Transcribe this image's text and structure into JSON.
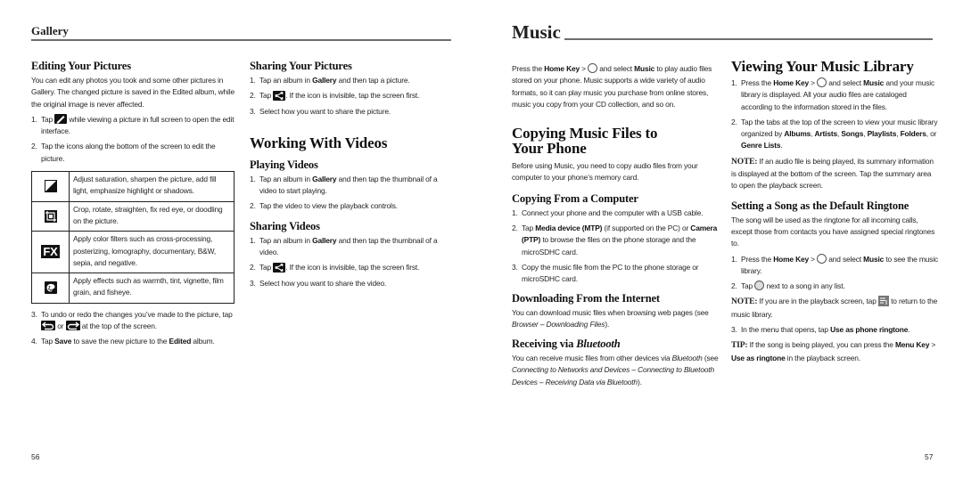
{
  "left_page": {
    "running_head": "Gallery",
    "page_number": "56",
    "editing": {
      "title": "Editing Your Pictures",
      "intro": "You can edit any photos you took and some other pictures in Gallery. The changed picture is saved in the Edited album, while the original image is never affected.",
      "step1_pre": "Tap",
      "step1_icon": "pencil-edit-icon",
      "step1_post": "while viewing a picture in full screen to open the edit interface.",
      "step2": "Tap the icons along the bottom of the screen to edit the picture.",
      "tools": [
        {
          "icon": "adjust-exposure-icon",
          "text": "Adjust saturation, sharpen the picture, add fill light, emphasize highlight or shadows."
        },
        {
          "icon": "crop-icon",
          "text": "Crop, rotate, straighten, fix red eye, or doodling on the picture."
        },
        {
          "icon": "fx-icon",
          "icon_text": "FX",
          "text": "Apply color filters such as cross-processing, posterizing, lomography, documentary, B&W, sepia, and negative."
        },
        {
          "icon": "palette-effects-icon",
          "text": "Apply effects such as warmth, tint, vignette, film grain, and fisheye."
        }
      ],
      "step3_pre": "To undo or redo the changes you’ve made to the picture, tap",
      "step3_mid": "or",
      "step3_post": "at the top of the screen.",
      "step4_pre": "Tap",
      "step4_bold1": "Save",
      "step4_mid": "to save the new picture to the",
      "step4_bold2": "Edited",
      "step4_post": "album."
    },
    "sharing_pictures": {
      "title": "Sharing Your Pictures",
      "step1_pre": "Tap an album in",
      "step1_bold": "Gallery",
      "step1_post": "and then tap a picture.",
      "step2_pre": "Tap",
      "step2_post": ". If the icon is invisible, tap the screen first.",
      "step3": "Select how you want to share the picture."
    },
    "videos": {
      "title": "Working With Videos",
      "playing": {
        "title": "Playing Videos",
        "step1_pre": "Tap an album in",
        "step1_bold": "Gallery",
        "step1_post": "and then tap the thumbnail of a video to start playing.",
        "step2": "Tap the video to view the playback controls."
      },
      "sharing": {
        "title": "Sharing Videos",
        "step1_pre": "Tap an album in",
        "step1_bold": "Gallery",
        "step1_post": "and then tap the thumbnail of a video.",
        "step2_pre": "Tap",
        "step2_post": ". If the icon is invisible, tap the screen first.",
        "step3": "Select how you want to share the video."
      }
    }
  },
  "right_page": {
    "running_head": "Music",
    "page_number": "57",
    "intro_pre": "Press the",
    "intro_bold1": "Home Key",
    "intro_gt": ">",
    "intro_mid": "and select",
    "intro_bold2": "Music",
    "intro_post": "to play audio files stored on your phone. Music supports a wide variety of audio formats, so it can play music you purchase from online stores, music you copy from your CD collection, and so on.",
    "copying": {
      "title": "Copying Music Files to Your Phone",
      "intro": "Before using Music, you need to copy audio files from your computer to your phone’s memory card.",
      "from_computer": {
        "title": "Copying From a Computer",
        "step1": "Connect your phone and the computer with a USB cable.",
        "step2_pre": "Tap",
        "step2_bold1": "Media device (MTP)",
        "step2_mid": "(if supported on the PC) or",
        "step2_bold2": "Camera (PTP)",
        "step2_post": "to browse the files on the phone storage and the microSDHC card.",
        "step3": "Copy the music file from the PC to the phone storage or microSDHC card."
      },
      "internet": {
        "title": "Downloading From the Internet",
        "text_pre": "You can download music files when browsing web pages (see",
        "text_italic": "Browser – Downloading Files",
        "text_post": ")."
      },
      "bluetooth": {
        "title_pre": "Receiving via",
        "title_italic": "Bluetooth",
        "text_pre": "You can receive music files from other devices via",
        "text_italic1": "Bluetooth",
        "text_mid": "(see",
        "text_italic2": "Connecting to Networks and Devices – Connecting to Bluetooth Devices – Receiving Data via Bluetooth",
        "text_post": ")."
      }
    },
    "library": {
      "title": "Viewing Your Music Library",
      "step1_pre": "Press the",
      "step1_bold1": "Home Key",
      "step1_gt": ">",
      "step1_mid": "and select",
      "step1_bold2": "Music",
      "step1_post": "and your music library is displayed. All your audio files are cataloged according to the information stored in the files.",
      "step2_pre": "Tap the tabs at the top of the screen to view your music library organized by",
      "tabs": [
        "Albums",
        "Artists",
        "Songs",
        "Playlists",
        "Folders"
      ],
      "step2_or": "or",
      "tab_last": "Genre Lists",
      "note_label": "NOTE:",
      "note_text": "If an audio file is being played, its summary information is displayed at the bottom of the screen. Tap the summary area to open the playback screen."
    },
    "ringtone": {
      "title": "Setting a Song as the Default Ringtone",
      "intro": "The song will be used as the ringtone for all incoming calls, except those from contacts you have assigned special ringtones to.",
      "step1_pre": "Press the",
      "step1_bold1": "Home Key",
      "step1_gt": ">",
      "step1_mid": "and select",
      "step1_bold2": "Music",
      "step1_post": "to see the music library.",
      "step2_pre": "Tap",
      "step2_post": "next to a song in any list.",
      "note_label": "NOTE:",
      "note_pre": "If you are in the playback screen, tap",
      "note_post": "to return to the music library.",
      "step3_pre": "In the menu that opens, tap",
      "step3_bold": "Use as phone ringtone",
      "step3_post": ".",
      "tip_label": "TIP:",
      "tip_pre": "If the song is being played, you can press the",
      "tip_bold1": "Menu Key",
      "tip_gt": ">",
      "tip_bold2": "Use as ringtone",
      "tip_post": "in the playback screen."
    }
  }
}
